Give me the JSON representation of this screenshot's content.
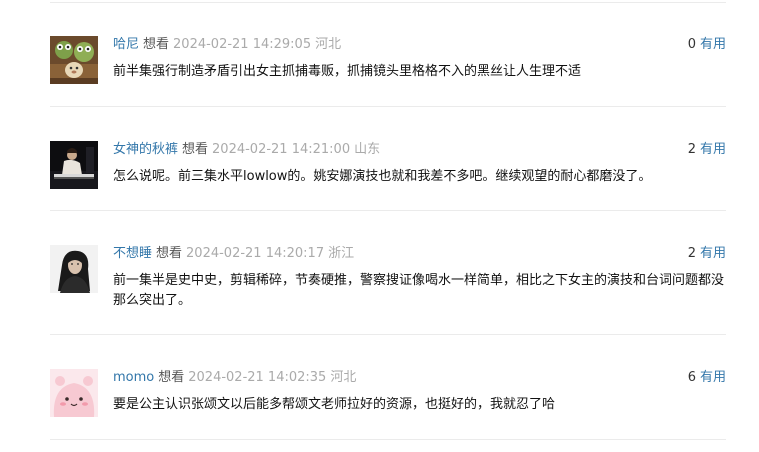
{
  "comments": [
    {
      "username": "哈尼",
      "status": "想看",
      "time": "2024-02-21 14:29:05",
      "location": "河北",
      "votes": "0",
      "useful_label": "有用",
      "content": "前半集强行制造矛盾引出女主抓捕毒贩，抓捕镜头里格格不入的黑丝让人生理不适",
      "avatar_icon": "toy-figures-avatar-icon"
    },
    {
      "username": "女神的秋裤",
      "status": "想看",
      "time": "2024-02-21 14:21:00",
      "location": "山东",
      "votes": "2",
      "useful_label": "有用",
      "content": "怎么说呢。前三集水平lowlow的。姚安娜演技也就和我差不多吧。继续观望的耐心都磨没了。",
      "avatar_icon": "pianist-photo-avatar-icon"
    },
    {
      "username": "不想睡",
      "status": "想看",
      "time": "2024-02-21 14:20:17",
      "location": "浙江",
      "votes": "2",
      "useful_label": "有用",
      "content": "前一集半是史中史，剪辑稀碎，节奏硬推，警察搜证像喝水一样简单，相比之下女主的演技和台词问题都没那么突出了。",
      "avatar_icon": "portrait-photo-avatar-icon"
    },
    {
      "username": "momo",
      "status": "想看",
      "time": "2024-02-21 14:02:35",
      "location": "河北",
      "votes": "6",
      "useful_label": "有用",
      "content": "要是公主认识张颂文以后能多帮颂文老师拉好的资源，也挺好的，我就忍了哈",
      "avatar_icon": "pink-cartoon-avatar-icon"
    }
  ],
  "colors": {
    "link": "#3377aa",
    "meta_gray": "#aaaaaa",
    "divider": "#ebebeb",
    "text": "#111111"
  }
}
